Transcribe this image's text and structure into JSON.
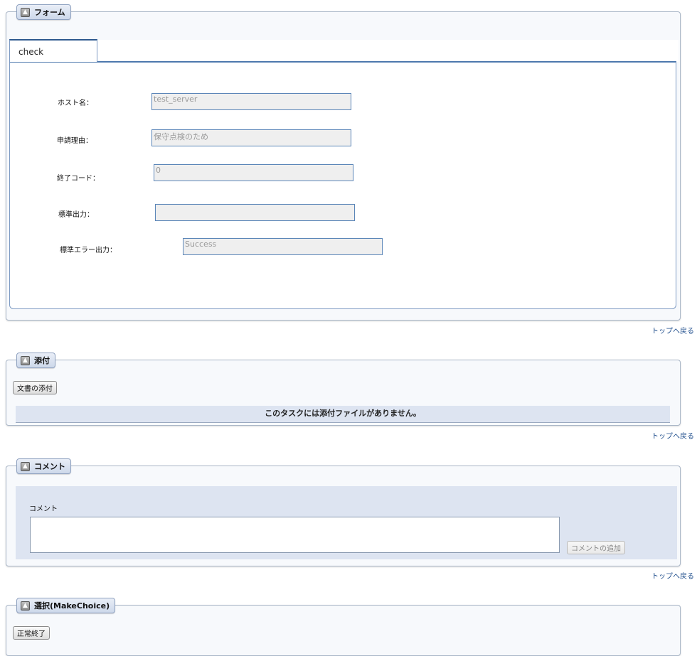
{
  "form_panel": {
    "title": "フォーム",
    "tab_label": "check",
    "fields": [
      {
        "label": "ホスト名：",
        "value": "test_server"
      },
      {
        "label": "申請理由：",
        "value": "保守点検のため"
      },
      {
        "label": "終了コード：",
        "value": "0"
      },
      {
        "label": "標準出力：",
        "value": ""
      },
      {
        "label": "標準エラー出力：",
        "value": "Success"
      }
    ],
    "top_link": "トップへ戻る"
  },
  "attach_panel": {
    "title": "添付",
    "attach_button": "文書の添付",
    "empty_message": "このタスクには添付ファイルがありません。",
    "top_link": "トップへ戻る"
  },
  "comment_panel": {
    "title": "コメント",
    "field_label": "コメント",
    "textarea_value": "",
    "add_button": "コメントの追加",
    "top_link": "トップへ戻る"
  },
  "choice_panel": {
    "title": "選択(MakeChoice)",
    "complete_button": "正常終了"
  },
  "icons": {
    "panel_toggle": "collapse-up-icon",
    "scroll_up": "chevron-up-icon",
    "scroll_down": "chevron-down-icon"
  },
  "colors": {
    "panel_bg": "#f7f9fc",
    "panel_border": "#a9b6c7",
    "input_border": "#5b86b8",
    "banner_bg": "#dde4f1",
    "link": "#1a4a8a"
  }
}
